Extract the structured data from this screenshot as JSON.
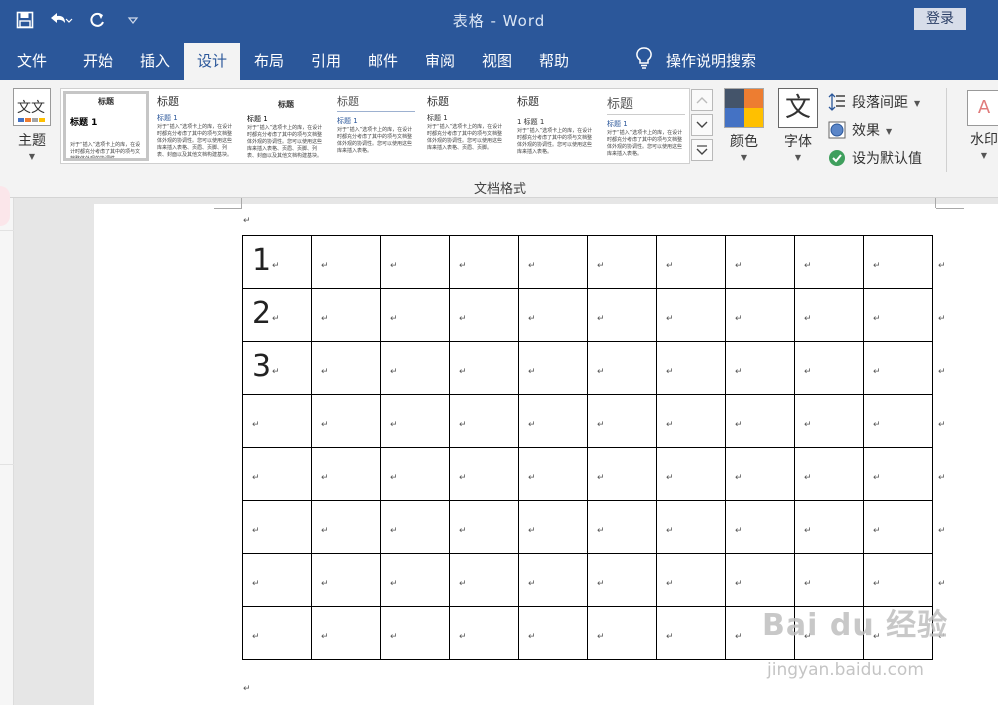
{
  "window": {
    "title": "表格  -  Word",
    "login": "登录"
  },
  "qat": {
    "save": "save-icon",
    "undo": "undo-icon",
    "redo": "redo-icon",
    "customize": "customize-icon"
  },
  "tabs": [
    "文件",
    "开始",
    "插入",
    "设计",
    "布局",
    "引用",
    "邮件",
    "审阅",
    "视图",
    "帮助"
  ],
  "active_tab": "设计",
  "tell_me": "操作说明搜索",
  "ribbon": {
    "theme_label": "主题",
    "theme_icon_text": "文文",
    "gallery": [
      {
        "title": "标题",
        "h1": "标题 1",
        "body": "对于“插入”选项卡上的库，在设计时都充分考虑了其中的项与文档整体外观的协调性。"
      },
      {
        "title": "标题",
        "h1": "标题 1",
        "body": "对于“插入”选项卡上的库，在设计时都充分考虑了其中的项与文档整体外观的协调性。您可以使用这些库来插入表格、页眉、页脚、列表、封面以及其他文档构建基块。"
      },
      {
        "title": "标题",
        "h1": "标题 1",
        "body": "对于“插入”选项卡上的库，在设计时都充分考虑了其中的项与文档整体外观的协调性。您可以使用这些库来插入表格、页眉、页脚、列表、封面以及其他文档构建基块。"
      },
      {
        "title": "标题",
        "h1": "标题 1",
        "body": "对于“插入”选项卡上的库，在设计时都充分考虑了其中的项与文档整体外观的协调性。您可以使用这些库来插入表格。"
      },
      {
        "title": "标题",
        "h1": "标题 1",
        "body": "对于“插入”选项卡上的库，在设计时都充分考虑了其中的项与文档整体外观的协调性。您可以使用这些库来插入表格、页眉、页脚。"
      },
      {
        "title": "标题",
        "h1": "1 标题 1",
        "body": "对于“插入”选项卡上的库，在设计时都充分考虑了其中的项与文档整体外观的协调性。您可以使用这些库来插入表格。"
      },
      {
        "title": "标题",
        "h1": "标题 1",
        "body": "对于“插入”选项卡上的库，在设计时都充分考虑了其中的项与文档整体外观的协调性。您可以使用这些库来插入表格。"
      }
    ],
    "group_label": "文档格式",
    "colors_label": "颜色",
    "fonts_label": "字体",
    "fonts_icon_text": "文",
    "paragraph_spacing": "段落间距",
    "effects": "效果",
    "set_default": "设为默认值",
    "watermark": "水印",
    "swatch_colors": [
      "#44546a",
      "#ed7d31",
      "#4472c4",
      "#ffc000"
    ]
  },
  "document": {
    "para_mark": "↵",
    "table_rows": [
      [
        "1",
        "",
        "",
        "",
        "",
        "",
        "",
        "",
        "",
        ""
      ],
      [
        "2",
        "",
        "",
        "",
        "",
        "",
        "",
        "",
        "",
        ""
      ],
      [
        "3",
        "",
        "",
        "",
        "",
        "",
        "",
        "",
        "",
        ""
      ],
      [
        "",
        "",
        "",
        "",
        "",
        "",
        "",
        "",
        "",
        ""
      ],
      [
        "",
        "",
        "",
        "",
        "",
        "",
        "",
        "",
        "",
        ""
      ],
      [
        "",
        "",
        "",
        "",
        "",
        "",
        "",
        "",
        "",
        ""
      ],
      [
        "",
        "",
        "",
        "",
        "",
        "",
        "",
        "",
        "",
        ""
      ],
      [
        "",
        "",
        "",
        "",
        "",
        "",
        "",
        "",
        "",
        ""
      ]
    ]
  },
  "watermark_overlay": {
    "logo": "Bai du 经验",
    "url": "jingyan.baidu.com"
  }
}
